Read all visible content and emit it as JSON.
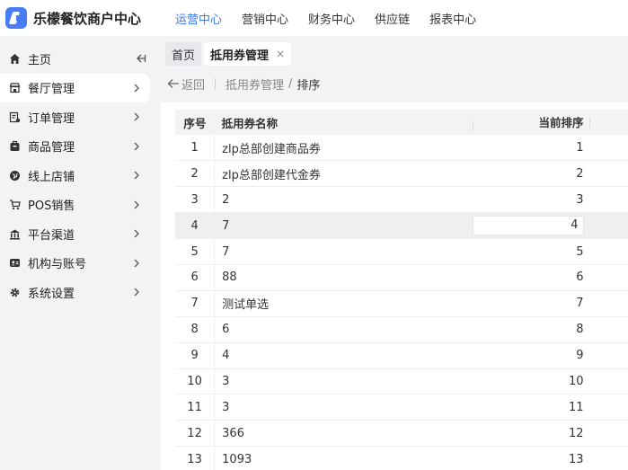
{
  "brand": {
    "title": "乐檬餐饮商户中心"
  },
  "topnav": [
    {
      "label": "运营中心",
      "active": true
    },
    {
      "label": "营销中心",
      "active": false
    },
    {
      "label": "财务中心",
      "active": false
    },
    {
      "label": "供应链",
      "active": false
    },
    {
      "label": "报表中心",
      "active": false
    }
  ],
  "sidebar": {
    "items": [
      {
        "label": "主页",
        "icon": "home-icon"
      },
      {
        "label": "餐厅管理",
        "icon": "restaurant-icon"
      },
      {
        "label": "订单管理",
        "icon": "order-icon"
      },
      {
        "label": "商品管理",
        "icon": "goods-icon"
      },
      {
        "label": "线上店铺",
        "icon": "online-store-icon"
      },
      {
        "label": "POS销售",
        "icon": "cart-icon"
      },
      {
        "label": "平台渠道",
        "icon": "platform-icon"
      },
      {
        "label": "机构与账号",
        "icon": "account-icon"
      },
      {
        "label": "系统设置",
        "icon": "gear-icon"
      }
    ]
  },
  "tabs": {
    "home": "首页",
    "current": "抵用券管理",
    "close": "×"
  },
  "crumbs": {
    "back": "返回",
    "parent": "抵用券管理",
    "slash": "/",
    "current": "排序"
  },
  "table": {
    "headers": {
      "no": "序号",
      "name": "抵用券名称",
      "rank": "当前排序"
    },
    "rows": [
      {
        "no": "1",
        "name": "zlp总部创建商品券",
        "rank": "1"
      },
      {
        "no": "2",
        "name": "zlp总部创建代金券",
        "rank": "2"
      },
      {
        "no": "3",
        "name": "2",
        "rank": "3"
      },
      {
        "no": "4",
        "name": "7",
        "rank": "4"
      },
      {
        "no": "5",
        "name": "7",
        "rank": "5"
      },
      {
        "no": "6",
        "name": "88",
        "rank": "6"
      },
      {
        "no": "7",
        "name": "测试单选",
        "rank": "7"
      },
      {
        "no": "8",
        "name": "6",
        "rank": "8"
      },
      {
        "no": "9",
        "name": "4",
        "rank": "9"
      },
      {
        "no": "10",
        "name": "3",
        "rank": "10"
      },
      {
        "no": "11",
        "name": "3",
        "rank": "11"
      },
      {
        "no": "12",
        "name": "366",
        "rank": "12"
      },
      {
        "no": "13",
        "name": "1093",
        "rank": "13"
      }
    ]
  },
  "colors": {
    "accent": "#3a77f6",
    "logo": "#4a7df5"
  }
}
